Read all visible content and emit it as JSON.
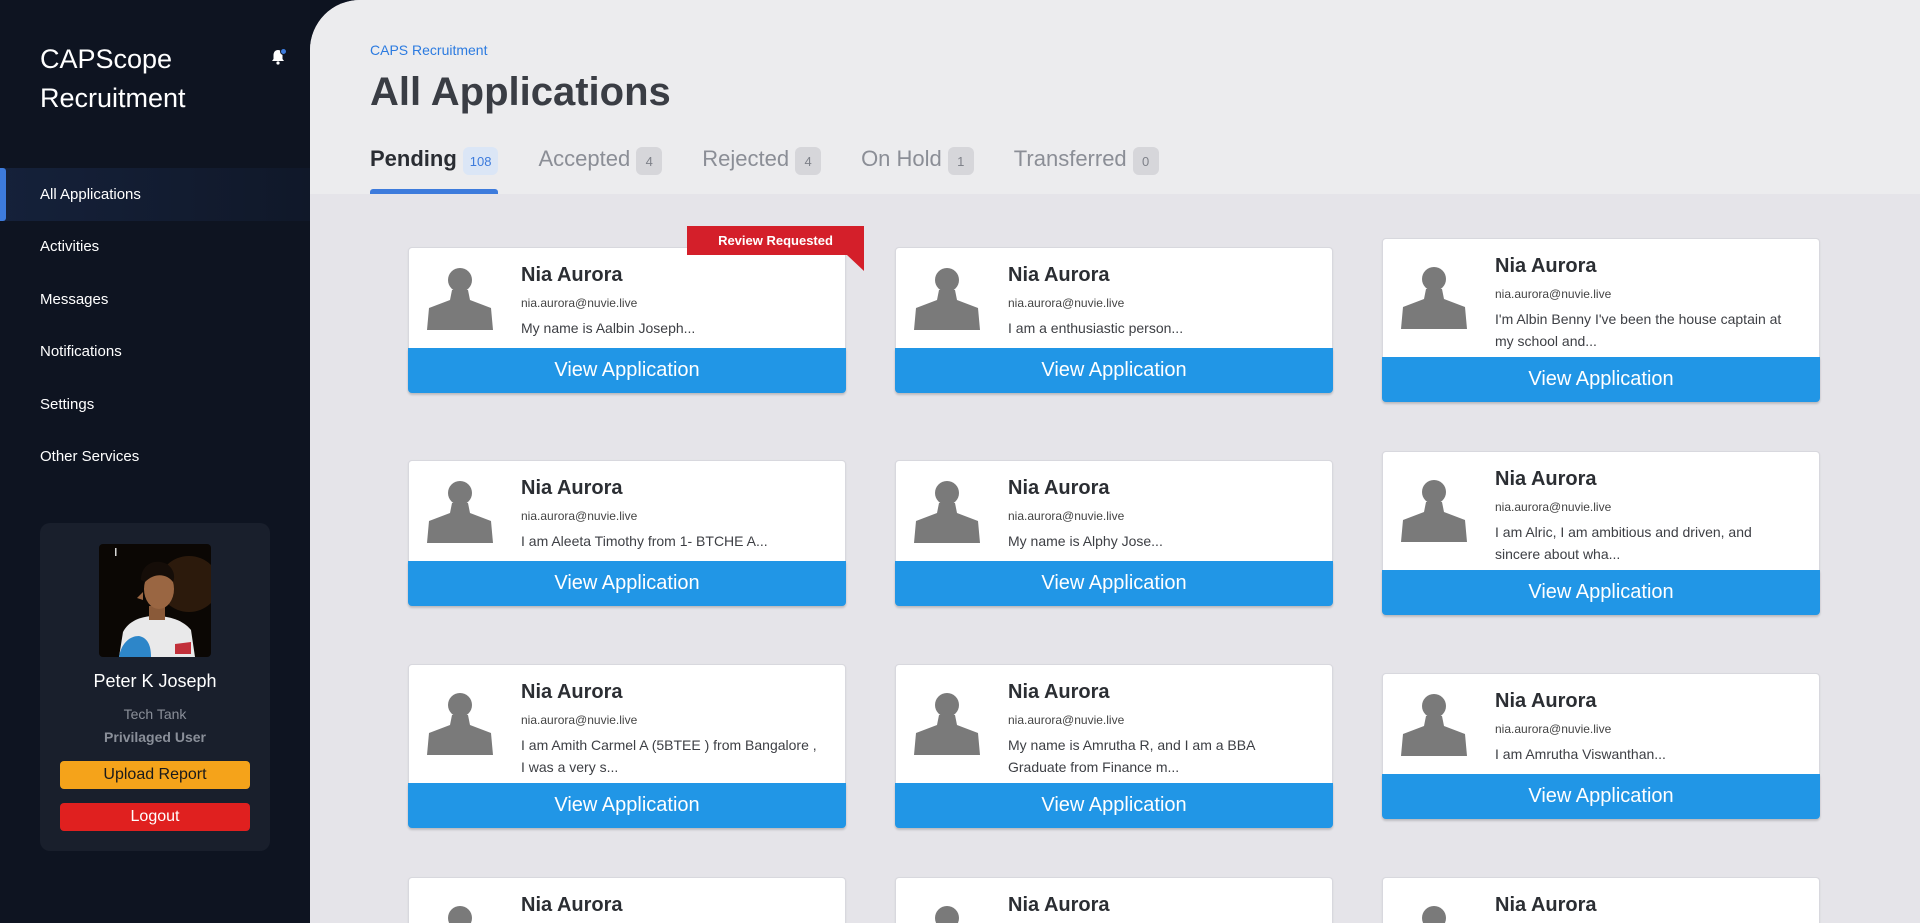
{
  "app": {
    "brand_line1": "CAPScope",
    "brand_line2": "Recruitment"
  },
  "sidebar": {
    "items": [
      {
        "label": "All Applications",
        "active": true
      },
      {
        "label": "Activities"
      },
      {
        "label": "Messages"
      },
      {
        "label": "Notifications"
      },
      {
        "label": "Settings"
      },
      {
        "label": "Other Services"
      }
    ]
  },
  "profile": {
    "name": "Peter K Joseph",
    "team": "Tech Tank",
    "role": "Privilaged User",
    "upload_label": "Upload Report",
    "logout_label": "Logout"
  },
  "header": {
    "breadcrumb": "CAPS Recruitment",
    "title": "All Applications",
    "tabs": [
      {
        "label": "Pending",
        "count": "108",
        "active": true
      },
      {
        "label": "Accepted",
        "count": "4"
      },
      {
        "label": "Rejected",
        "count": "4"
      },
      {
        "label": "On Hold",
        "count": "1"
      },
      {
        "label": "Transferred",
        "count": "0"
      }
    ]
  },
  "ribbon_label": "Review Requested",
  "view_label": "View Application",
  "cards": [
    {
      "name": "Nia Aurora",
      "email": "nia.aurora@nuvie.live",
      "desc": "My name is Aalbin Joseph..."
    },
    {
      "name": "Nia Aurora",
      "email": "nia.aurora@nuvie.live",
      "desc": "I am a enthusiastic person..."
    },
    {
      "name": "Nia Aurora",
      "email": "nia.aurora@nuvie.live",
      "desc": "I'm Albin Benny I've been the house captain at my school and..."
    },
    {
      "name": "Nia Aurora",
      "email": "nia.aurora@nuvie.live",
      "desc": "I am Aleeta Timothy from 1- BTCHE A..."
    },
    {
      "name": "Nia Aurora",
      "email": "nia.aurora@nuvie.live",
      "desc": "My name is Alphy Jose..."
    },
    {
      "name": "Nia Aurora",
      "email": "nia.aurora@nuvie.live",
      "desc": "I am Alric, I am ambitious and driven, and sincere about wha..."
    },
    {
      "name": "Nia Aurora",
      "email": "nia.aurora@nuvie.live",
      "desc": "I am Amith Carmel A (5BTEE ) from Bangalore , I was a very s..."
    },
    {
      "name": "Nia Aurora",
      "email": "nia.aurora@nuvie.live",
      "desc": "My name is Amrutha R, and I am a BBA Graduate from Finance m..."
    },
    {
      "name": "Nia Aurora",
      "email": "nia.aurora@nuvie.live",
      "desc": "I am Amrutha Viswanthan..."
    },
    {
      "name": "Nia Aurora"
    },
    {
      "name": "Nia Aurora"
    },
    {
      "name": "Nia Aurora"
    }
  ],
  "colors": {
    "sidebar_bg": "#0e1421",
    "accent": "#3d7bdc",
    "view_button": "#2196e6",
    "ribbon": "#d41f2a",
    "upload": "#f5a31a",
    "logout": "#e0201f"
  }
}
